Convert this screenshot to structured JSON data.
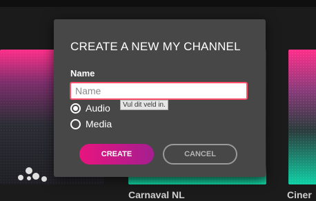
{
  "background": {
    "card_titles": [
      "Carnaval NL",
      "Ciner"
    ]
  },
  "dialog": {
    "title": "CREATE A NEW MY CHANNEL",
    "name_label": "Name",
    "name_value": "",
    "name_placeholder": "Name",
    "validation_tooltip": "Vul dit veld in.",
    "options": [
      {
        "label": "Audio",
        "selected": true
      },
      {
        "label": "Media",
        "selected": false
      }
    ],
    "create_label": "CREATE",
    "cancel_label": "CANCEL"
  },
  "colors": {
    "accent": "#e8147f",
    "dialog_bg": "#474747",
    "input_error_border": "#ff4e6a"
  }
}
